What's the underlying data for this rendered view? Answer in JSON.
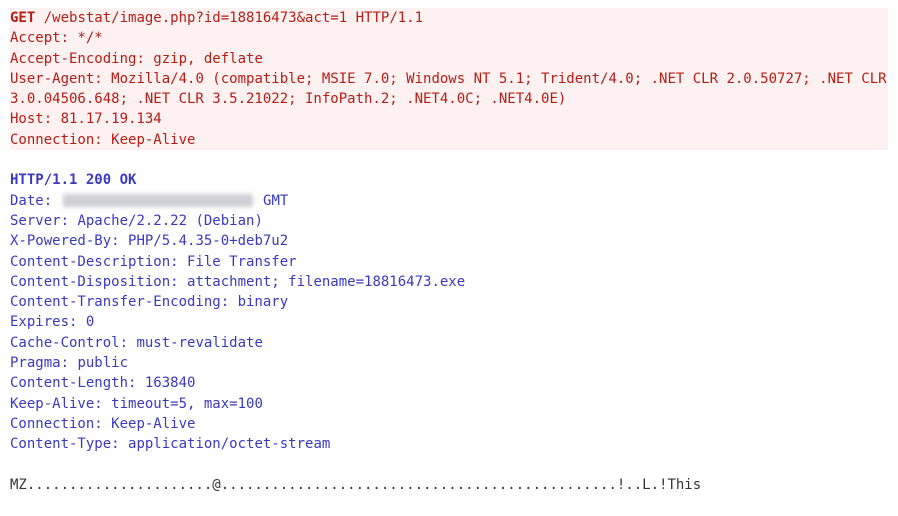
{
  "request": {
    "method": "GET",
    "path": "/webstat/image.php?id=18816473&act=1",
    "protocol": "HTTP/1.1",
    "headers": [
      {
        "name": "Accept",
        "value": "*/*"
      },
      {
        "name": "Accept-Encoding",
        "value": "gzip, deflate"
      },
      {
        "name": "User-Agent",
        "value": "Mozilla/4.0 (compatible; MSIE 7.0; Windows NT 5.1; Trident/4.0; .NET CLR 2.0.50727; .NET CLR 3.0.04506.648; .NET CLR 3.5.21022; InfoPath.2; .NET4.0C; .NET4.0E)"
      },
      {
        "name": "Host",
        "value": "81.17.19.134"
      },
      {
        "name": "Connection",
        "value": "Keep-Alive"
      }
    ]
  },
  "response": {
    "status_line": "HTTP/1.1 200 OK",
    "headers": [
      {
        "name": "Date",
        "value": "████████████████████ GMT",
        "redacted_prefix": true,
        "suffix": "GMT"
      },
      {
        "name": "Server",
        "value": "Apache/2.2.22 (Debian)"
      },
      {
        "name": "X-Powered-By",
        "value": "PHP/5.4.35-0+deb7u2"
      },
      {
        "name": "Content-Description",
        "value": "File Transfer"
      },
      {
        "name": "Content-Disposition",
        "value": "attachment; filename=18816473.exe"
      },
      {
        "name": "Content-Transfer-Encoding",
        "value": "binary"
      },
      {
        "name": "Expires",
        "value": "0"
      },
      {
        "name": "Cache-Control",
        "value": "must-revalidate"
      },
      {
        "name": "Pragma",
        "value": "public"
      },
      {
        "name": "Content-Length",
        "value": "163840"
      },
      {
        "name": "Keep-Alive",
        "value": "timeout=5, max=100"
      },
      {
        "name": "Connection",
        "value": "Keep-Alive"
      },
      {
        "name": "Content-Type",
        "value": "application/octet-stream"
      }
    ]
  },
  "body_preview": "MZ......................@...............................................!..L.!This"
}
